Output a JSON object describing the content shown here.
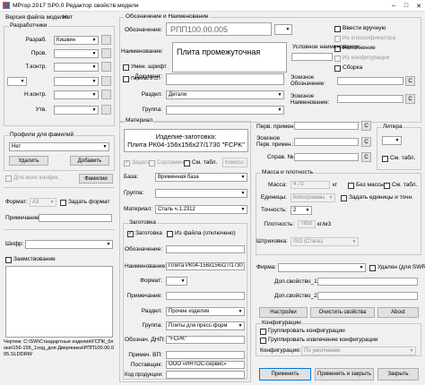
{
  "window": {
    "title": "MProp 2017 SP0.0   Редактор свойств модели"
  },
  "left": {
    "model_file_version_label": "Версия файла модели:",
    "model_file_version_value": "Нет",
    "developers": {
      "title": "Разработчики",
      "razrab_label": "Разраб.",
      "razrab_value": "Кишкин",
      "prov_label": "Пров.",
      "tkontr_label": "Т.контр.",
      "nkontr_label": "Н.контр.",
      "utv_label": "Утв."
    },
    "profiles": {
      "title": "Профили для фамилий",
      "profile_value": "Нет",
      "delete_label": "Удалить",
      "add_label": "Добавить",
      "all_configs_label": "Для всех конфиг.",
      "surnames_label": "Фамилии"
    },
    "format_label": "Формат:",
    "format_value": "A3",
    "set_format_label": "Задать формат",
    "note_label": "Примечание:",
    "shifr_label": "Шифр:",
    "borrowing_label": "Заимствование",
    "drawing_path": "Чертеж: C:\\SW\\Стандартные изделия\\ГСПК_блоки\\156-156_1ход_для Дверяника\\РПП100.00.005.SLDDRW"
  },
  "designation": {
    "title": "Обозначение и Наименование",
    "designation_label": "Обозначение:",
    "designation_value": "РПП100.00.005",
    "name_label": "Наименование:",
    "name_value": "Плита промежуточная",
    "reduce_font_label": "Умен. шрифт",
    "transfer_label": "Перенос в СП",
    "enter_manually_label": "Ввести вручную",
    "from_classifier_label": "Из классификатора",
    "execution_label": "Исполнение",
    "from_config_label": "Из конфигурации",
    "assembly_label": "Сборка",
    "conditional_name_label": "Условное наименование:",
    "document_label": "Документ:",
    "eskiz_designation_label": "Эскизное Обозначение:",
    "eskiz_name_label": "Эскизное Наименование:",
    "section_label": "Раздел:",
    "section_value": "Детали",
    "group_label": "Группа:",
    "c_label": "C"
  },
  "material": {
    "title": "Материал",
    "blank_line1": "Изделие-заготовка:",
    "blank_line2": "Плита РК04-156х156х27/1730 \"FCPK\"",
    "set_label": "Задать",
    "sortament_label": "Сортамент",
    "table_label": "См. табл.",
    "composite_label": "Композ.",
    "base_label": "База:",
    "base_value": "Временная база",
    "group_label": "Группа:",
    "material_label": "Материал:",
    "material_value": "Сталь ч.1.2312",
    "blank_group": {
      "title": "Заготовка",
      "blank_check_label": "Заготовка",
      "from_file_label": "Из файла (отключено)",
      "designation_label": "Обозначение:",
      "name_label": "Наименование:",
      "name_value": "Плита РК04-156х156х27/1730",
      "format_label": "Формат:",
      "note_label": "Примечание:",
      "section_label": "Раздел:",
      "section_value": "Прочие изделия",
      "group_label": "Группа:",
      "group_value": "Плиты для пресс-форм",
      "dnp_label": "Обознач. ДНП:",
      "dnp_value": "\"FCPK\"",
      "note_vp_label": "Примеч. ВП:",
      "supplier_label": "Поставщик:",
      "supplier_value": "ООО «ИНТОС-сервис»",
      "product_code_label": "Код продукции:"
    }
  },
  "primary": {
    "first_use_label": "Перв. примен.:",
    "eskiz_first_use_label": "Эскизное Перв. примен.:",
    "ref_label": "Справ. №:",
    "litera_title": "Литера",
    "table_label": "См. табл."
  },
  "mass": {
    "title": "Масса и плотность",
    "mass_label": "Масса:",
    "mass_value": "4,72",
    "mass_unit": "кг",
    "no_mass_label": "Без массы",
    "table_label": "См. табл.",
    "units_label": "Единицы:",
    "units_value": "Килограммы",
    "set_units_label": "Задать единицы и точн.",
    "precision_label": "Точность:",
    "precision_value": "2",
    "density_label": "Плотность:",
    "density_value": "7850",
    "density_unit": "кг/м3",
    "hatch_label": "Штриховка:",
    "hatch_value": "ISO (Сталь)"
  },
  "firm": {
    "firm_label": "Фирма:",
    "deleted_label": "Удален (для SWR)",
    "extra1_label": "Доп.свойство_1",
    "extra2_label": "Доп.свойство_2",
    "settings_label": "Настройки",
    "clear_label": "Очистить свойства",
    "about_label": "About"
  },
  "configs": {
    "title": "Конфигурации",
    "group_configs_label": "Группировать конфигурации",
    "group_extract_label": "Группировать извлечение конфигурации",
    "config_label": "Конфигурация:",
    "config_value": "По умолчанию"
  },
  "footer": {
    "apply_label": "Применить",
    "apply_close_label": "Применить и закрыть",
    "close_label": "Закрыть"
  }
}
